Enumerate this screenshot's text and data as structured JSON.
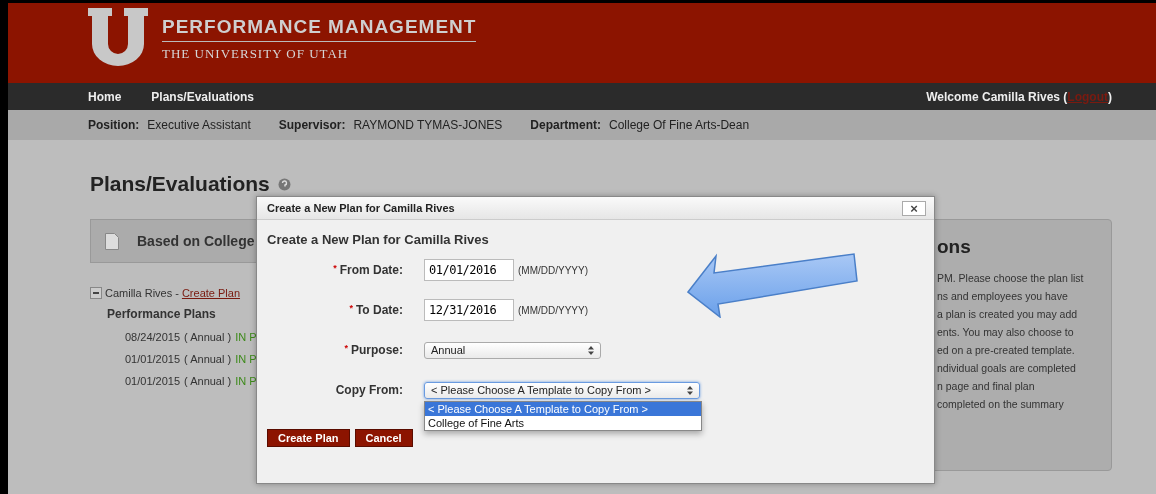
{
  "header": {
    "title": "PERFORMANCE MANAGEMENT",
    "subtitle": "THE UNIVERSITY OF UTAH"
  },
  "nav": {
    "items": [
      {
        "label": "Home"
      },
      {
        "label": "Plans/Evaluations"
      }
    ],
    "welcome": "Welcome Camilla Rives (",
    "logout": "Logout",
    "welcome_end": ")"
  },
  "info_bar": [
    {
      "label": "Position:",
      "value": "Executive Assistant"
    },
    {
      "label": "Supervisor:",
      "value": "RAYMOND TYMAS-JONES"
    },
    {
      "label": "Department:",
      "value": "College Of Fine Arts-Dean"
    }
  ],
  "page_title": "Plans/Evaluations",
  "template_box": {
    "label": "Based on College"
  },
  "tree": {
    "name": "Camilla Rives",
    "separator": "-",
    "link": "Create Plan",
    "expanded": true,
    "group": "Performance Plans",
    "children": [
      {
        "date": "08/24/2015",
        "type": "( Annual )",
        "status": "IN P"
      },
      {
        "date": "01/01/2015",
        "type": "( Annual )",
        "status": "IN P"
      },
      {
        "date": "01/01/2015",
        "type": "( Annual )",
        "status": "IN P"
      }
    ]
  },
  "instructions": {
    "title": "ons",
    "lines": [
      "PM. Please choose the plan list",
      "ns and employees you have",
      "a plan is created you may add",
      "ents. You may also choose to",
      "ed on a pre-created template.",
      "ndividual goals are completed",
      "n page and final plan",
      "completed on the summary"
    ]
  },
  "dialog": {
    "title": "Create a New Plan for Camilla Rives",
    "close": "×",
    "heading": "Create a New Plan for Camilla Rives",
    "fields": [
      {
        "kind": "date",
        "label": "From Date:",
        "required": true,
        "value": "01/01/2016",
        "hint": "(MM/DD/YYYY)"
      },
      {
        "kind": "date",
        "label": "To Date:",
        "required": true,
        "value": "12/31/2016",
        "hint": "(MM/DD/YYYY)"
      },
      {
        "kind": "select",
        "label": "Purpose:",
        "required": true,
        "value": "Annual",
        "focused": false
      },
      {
        "kind": "select",
        "label": "Copy From:",
        "required": false,
        "value": "< Please Choose A Template to Copy From >",
        "focused": true,
        "options": [
          {
            "label": "< Please Choose A Template to Copy From >",
            "selected": true
          },
          {
            "label": "College of Fine Arts",
            "selected": false
          }
        ]
      }
    ],
    "required_mark": "*",
    "buttons": [
      "Create Plan",
      "Cancel"
    ]
  }
}
